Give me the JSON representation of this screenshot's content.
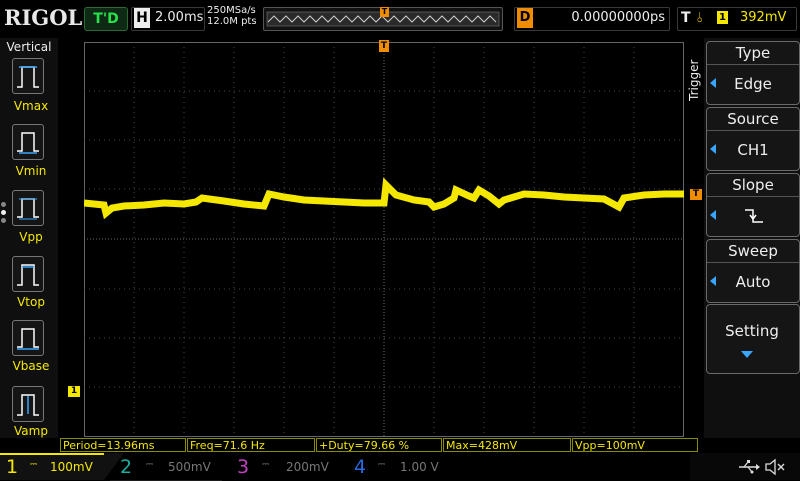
{
  "header": {
    "brand": "RIGOL",
    "run_status": "T'D",
    "horizontal": {
      "letter": "H",
      "timebase": "2.00ms"
    },
    "sample_rate": "250MSa/s",
    "memory_depth": "12.0M pts",
    "delay": {
      "letter": "D",
      "value": "0.00000000ps"
    },
    "trigger": {
      "letter": "T",
      "edge_symbol": "⫰",
      "source_badge": "1",
      "level": "392mV"
    }
  },
  "left_menu": {
    "title": "Vertical",
    "items": [
      {
        "label": "Vmax"
      },
      {
        "label": "Vmin"
      },
      {
        "label": "Vpp"
      },
      {
        "label": "Vtop"
      },
      {
        "label": "Vbase"
      },
      {
        "label": "Vamp"
      }
    ]
  },
  "right_menu": {
    "section_title": "Trigger",
    "type": {
      "title": "Type",
      "value": "Edge"
    },
    "source": {
      "title": "Source",
      "value": "CH1"
    },
    "slope": {
      "title": "Slope"
    },
    "sweep": {
      "title": "Sweep",
      "value": "Auto"
    },
    "setting": {
      "title": "Setting"
    }
  },
  "markers": {
    "trigger_pos": "T",
    "trigger_level": "T",
    "ch1_ground": "1"
  },
  "measurements": [
    "Period=13.96ms",
    "Freq=71.6 Hz",
    "+Duty=79.66 %",
    "Max=428mV",
    "Vpp=100mV"
  ],
  "channels": [
    {
      "number": "1",
      "scale": "100mV",
      "color": "#f5e800"
    },
    {
      "number": "2",
      "scale": "500mV",
      "color": "#18b0a0"
    },
    {
      "number": "3",
      "scale": "200mV",
      "color": "#c040c0"
    },
    {
      "number": "4",
      "scale": "1.00 V",
      "color": "#2a6ae0"
    }
  ],
  "colors": {
    "ch1": "#f5e800",
    "accent_blue": "#39a6ff",
    "trigger_orange": "#f08c00",
    "run_green": "#27e04a"
  }
}
